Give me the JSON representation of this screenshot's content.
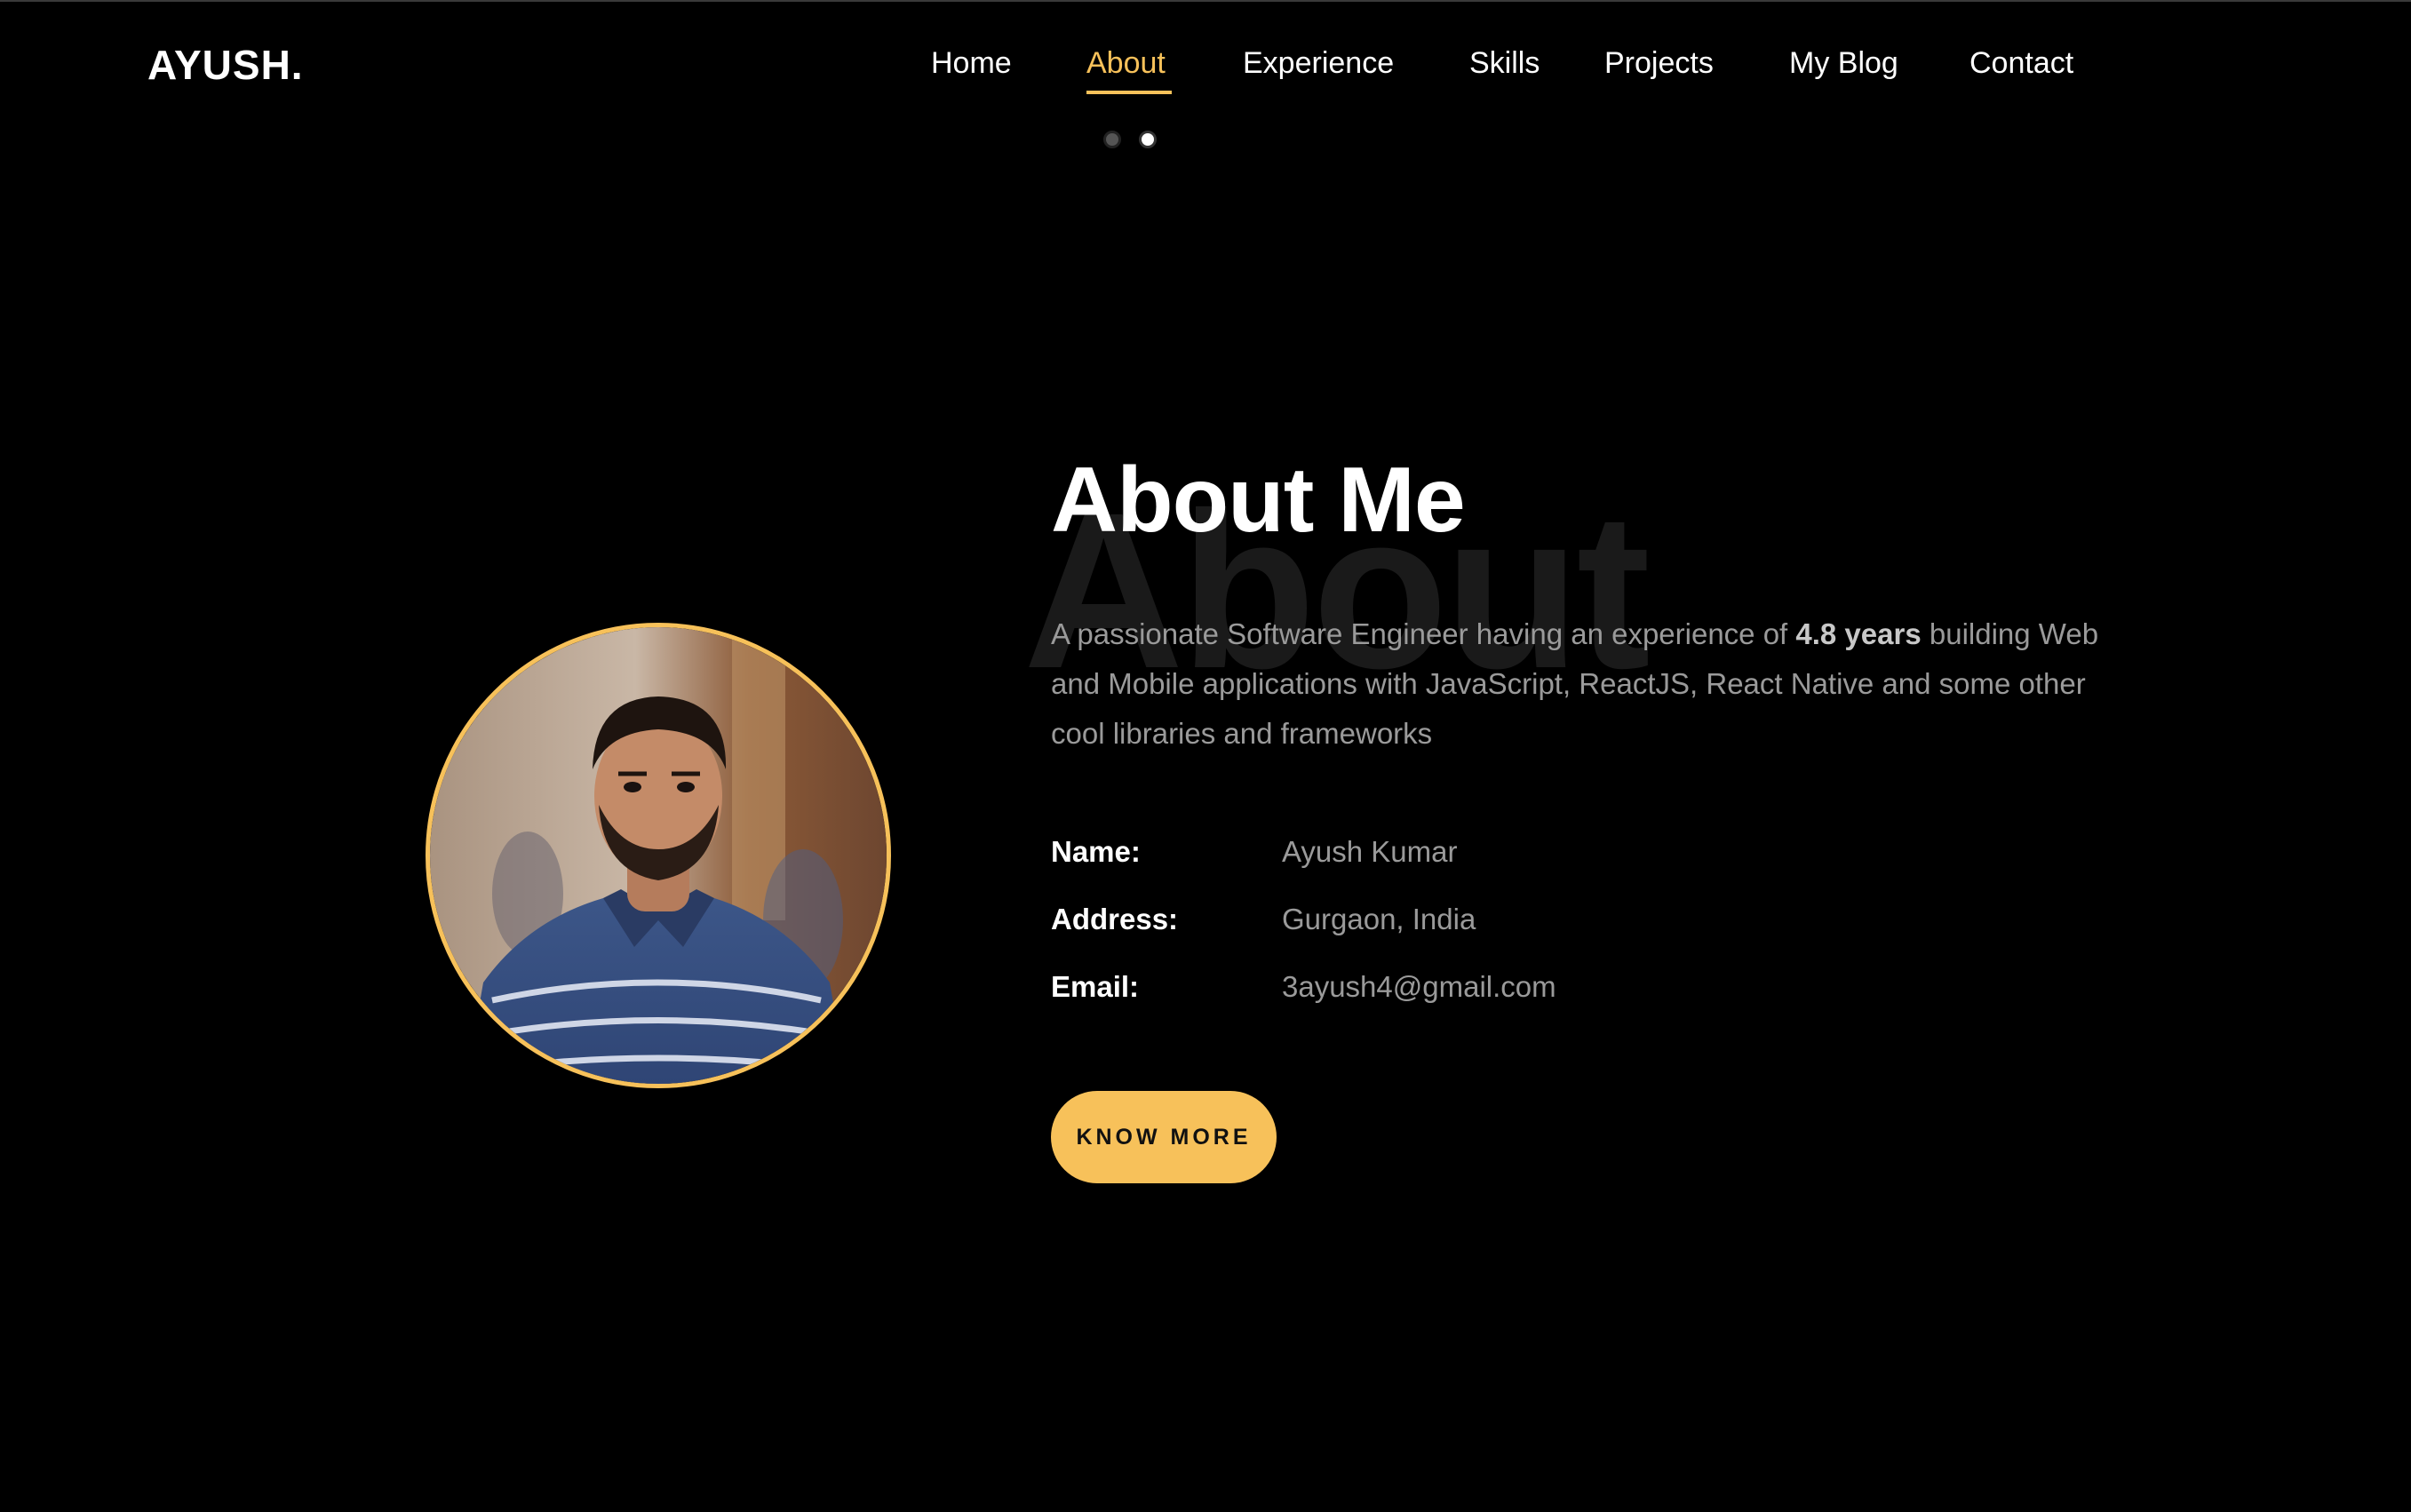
{
  "header": {
    "logo": "AYUSH.",
    "nav": [
      {
        "label": "Home"
      },
      {
        "label": "About"
      },
      {
        "label": "Experience"
      },
      {
        "label": "Skills"
      },
      {
        "label": "Projects"
      },
      {
        "label": "My Blog"
      },
      {
        "label": "Contact"
      }
    ],
    "active_nav": "About",
    "accent_color": "#f7c15a"
  },
  "about": {
    "background_word": "About",
    "title": "About Me",
    "description_before": "A passionate Software Engineer having an experience of ",
    "description_highlight": "4.8 years",
    "description_after": " building Web and Mobile applications with JavaScript, ReactJS, React Native and some other cool libraries and frameworks",
    "info": [
      {
        "label": "Name:",
        "value": "Ayush Kumar"
      },
      {
        "label": "Address:",
        "value": "Gurgaon, India"
      },
      {
        "label": "Email:",
        "value": "3ayush4@gmail.com"
      }
    ],
    "cta_label": "KNOW MORE"
  },
  "icons": {
    "theme_toggle": "toggle-dots-icon",
    "profile_photo": "profile-photo"
  }
}
